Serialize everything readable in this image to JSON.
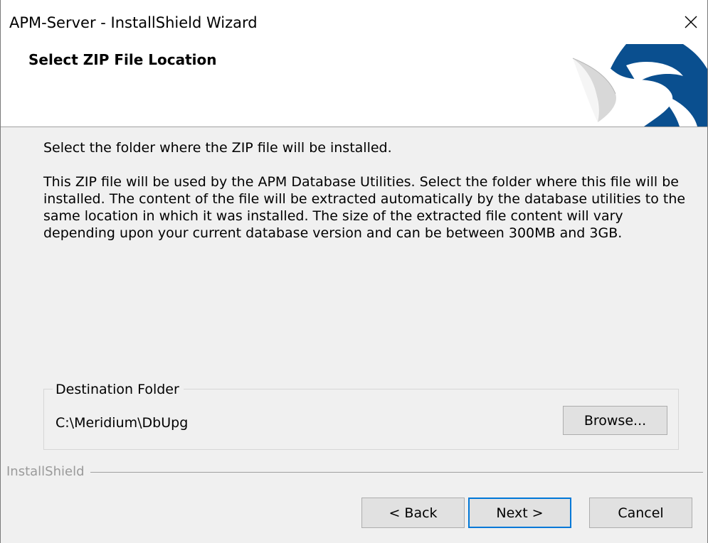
{
  "window": {
    "title": "APM-Server - InstallShield Wizard",
    "close_icon": "close-icon"
  },
  "header": {
    "title": "Select ZIP File Location",
    "logo_icon": "installshield-logo-icon",
    "brand_color": "#0a4f8f"
  },
  "main": {
    "intro": "Select the folder where the ZIP file will be installed.",
    "description": "This ZIP file will be used by the APM Database Utilities. Select the folder where this file will be installed. The content of the file will be extracted automatically by the database utilities to the same location in which it was installed. The size of the extracted file content will vary depending upon your current database version and can be between 300MB and 3GB."
  },
  "destination": {
    "legend": "Destination Folder",
    "path": "C:\\Meridium\\DbUpg",
    "browse_label": "Browse..."
  },
  "footer": {
    "brand": "InstallShield",
    "back_label": "< Back",
    "next_label": "Next >",
    "cancel_label": "Cancel",
    "focus_color": "#0078d7"
  }
}
